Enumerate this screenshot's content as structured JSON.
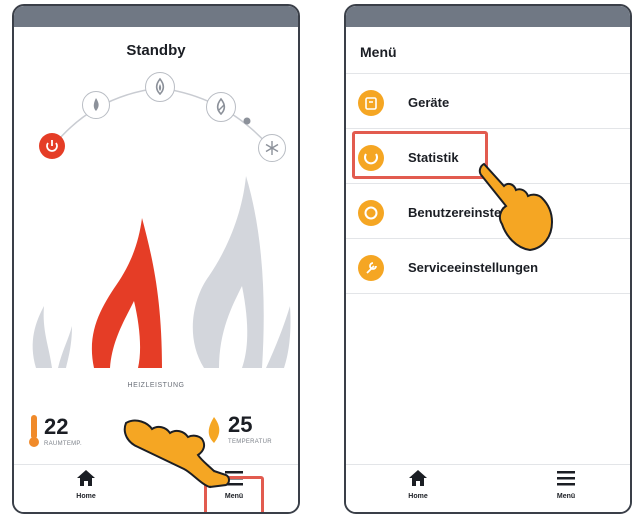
{
  "left_screen": {
    "title": "Standby",
    "heiz_label": "HEIZLEISTUNG",
    "room_temp": {
      "value": "22",
      "label": "RAUMTEMP."
    },
    "target_temp": {
      "value": "25",
      "label": "TEMPERATUR"
    },
    "mode_icons": [
      "power-icon",
      "drop-flame-icon",
      "leaf-flame-icon",
      "eco-flame-icon",
      "snowflake-icon"
    ]
  },
  "right_screen": {
    "title": "Menü",
    "items": [
      {
        "label": "Geräte",
        "icon": "device-icon"
      },
      {
        "label": "Statistik",
        "icon": "chart-icon"
      },
      {
        "label": "Benutzereinstellungen",
        "icon": "user-settings-icon"
      },
      {
        "label": "Serviceeinstellungen",
        "icon": "service-icon"
      }
    ]
  },
  "nav": {
    "home_label": "Home",
    "menu_label": "Menü"
  },
  "colors": {
    "accent": "#e53d26",
    "icon_orange": "#f5a623",
    "hand": "#f5a623",
    "highlight": "#e25b4f",
    "statusbar": "#707884"
  }
}
